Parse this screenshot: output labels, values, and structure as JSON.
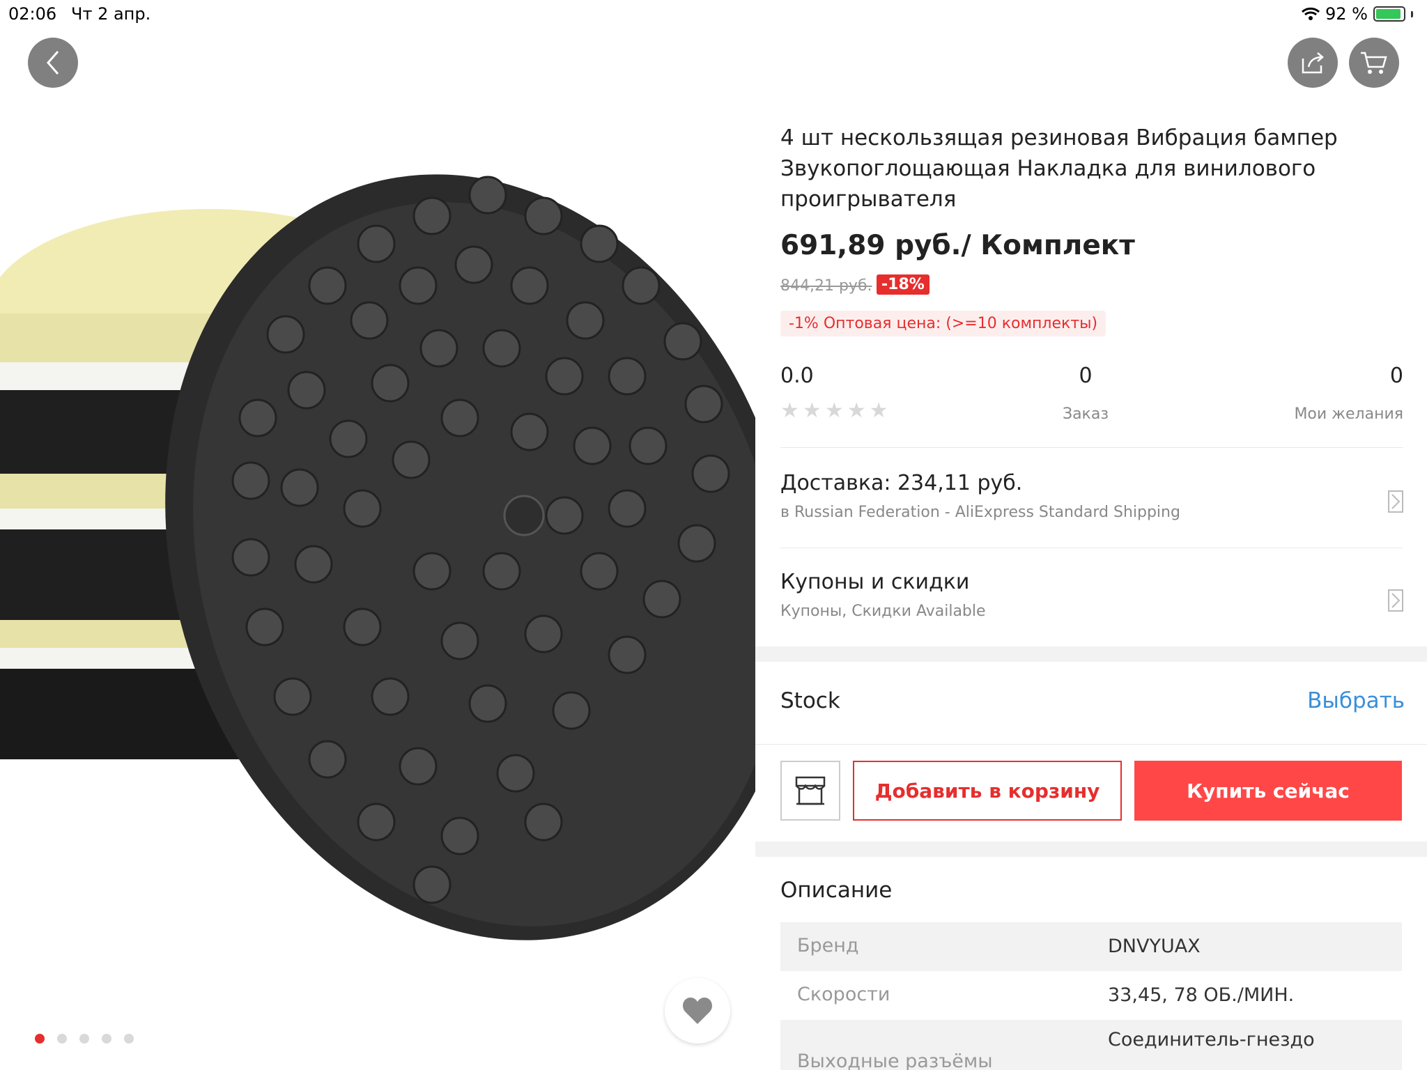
{
  "status_bar": {
    "time": "02:06",
    "date": "Чт 2 апр.",
    "battery": "92 %",
    "battery_level": 0.92
  },
  "gallery": {
    "image_count": 5,
    "active_index": 0
  },
  "product": {
    "title": "4 шт нескользящая резиновая Вибрация бампер Звукопоглощающая Накладка для винилового проигрывателя",
    "price": "691,89 руб./ Комплект",
    "old_price": "844,21 руб.",
    "discount": "-18%",
    "wholesale": "-1% Оптовая цена: (>=10 комплекты)"
  },
  "stats": {
    "rating": "0.0",
    "stars_filled": 0,
    "stars_total": 5,
    "orders_count": "0",
    "orders_label": "Заказ",
    "wishlist_count": "0",
    "wishlist_label": "Мои желания"
  },
  "delivery": {
    "title": "Доставка: 234,11 руб.",
    "subtitle": "в Russian Federation - AliExpress Standard Shipping"
  },
  "coupons": {
    "title": "Купоны и скидки",
    "subtitle": "Купоны, Скидки Available"
  },
  "stock": {
    "label": "Stock",
    "action": "Выбрать"
  },
  "actions": {
    "add_to_cart": "Добавить в корзину",
    "buy_now": "Купить сейчас"
  },
  "description": {
    "title": "Описание",
    "specs": [
      {
        "name": "Бренд",
        "value": "DNVYUAX"
      },
      {
        "name": "Скорости",
        "value": "33,45, 78 ОБ./МИН."
      },
      {
        "name": "Выходные разъёмы",
        "value": "Соединитель-гнездо"
      }
    ]
  },
  "colors": {
    "accent": "#ff4747",
    "accent_dark": "#e62e2e",
    "link": "#3a8fd8"
  },
  "icons": {
    "back": "chevron-left-icon",
    "share": "share-icon",
    "cart": "cart-icon",
    "wishlist": "heart-icon",
    "store": "store-icon",
    "chevron": "chevron-right-icon"
  }
}
